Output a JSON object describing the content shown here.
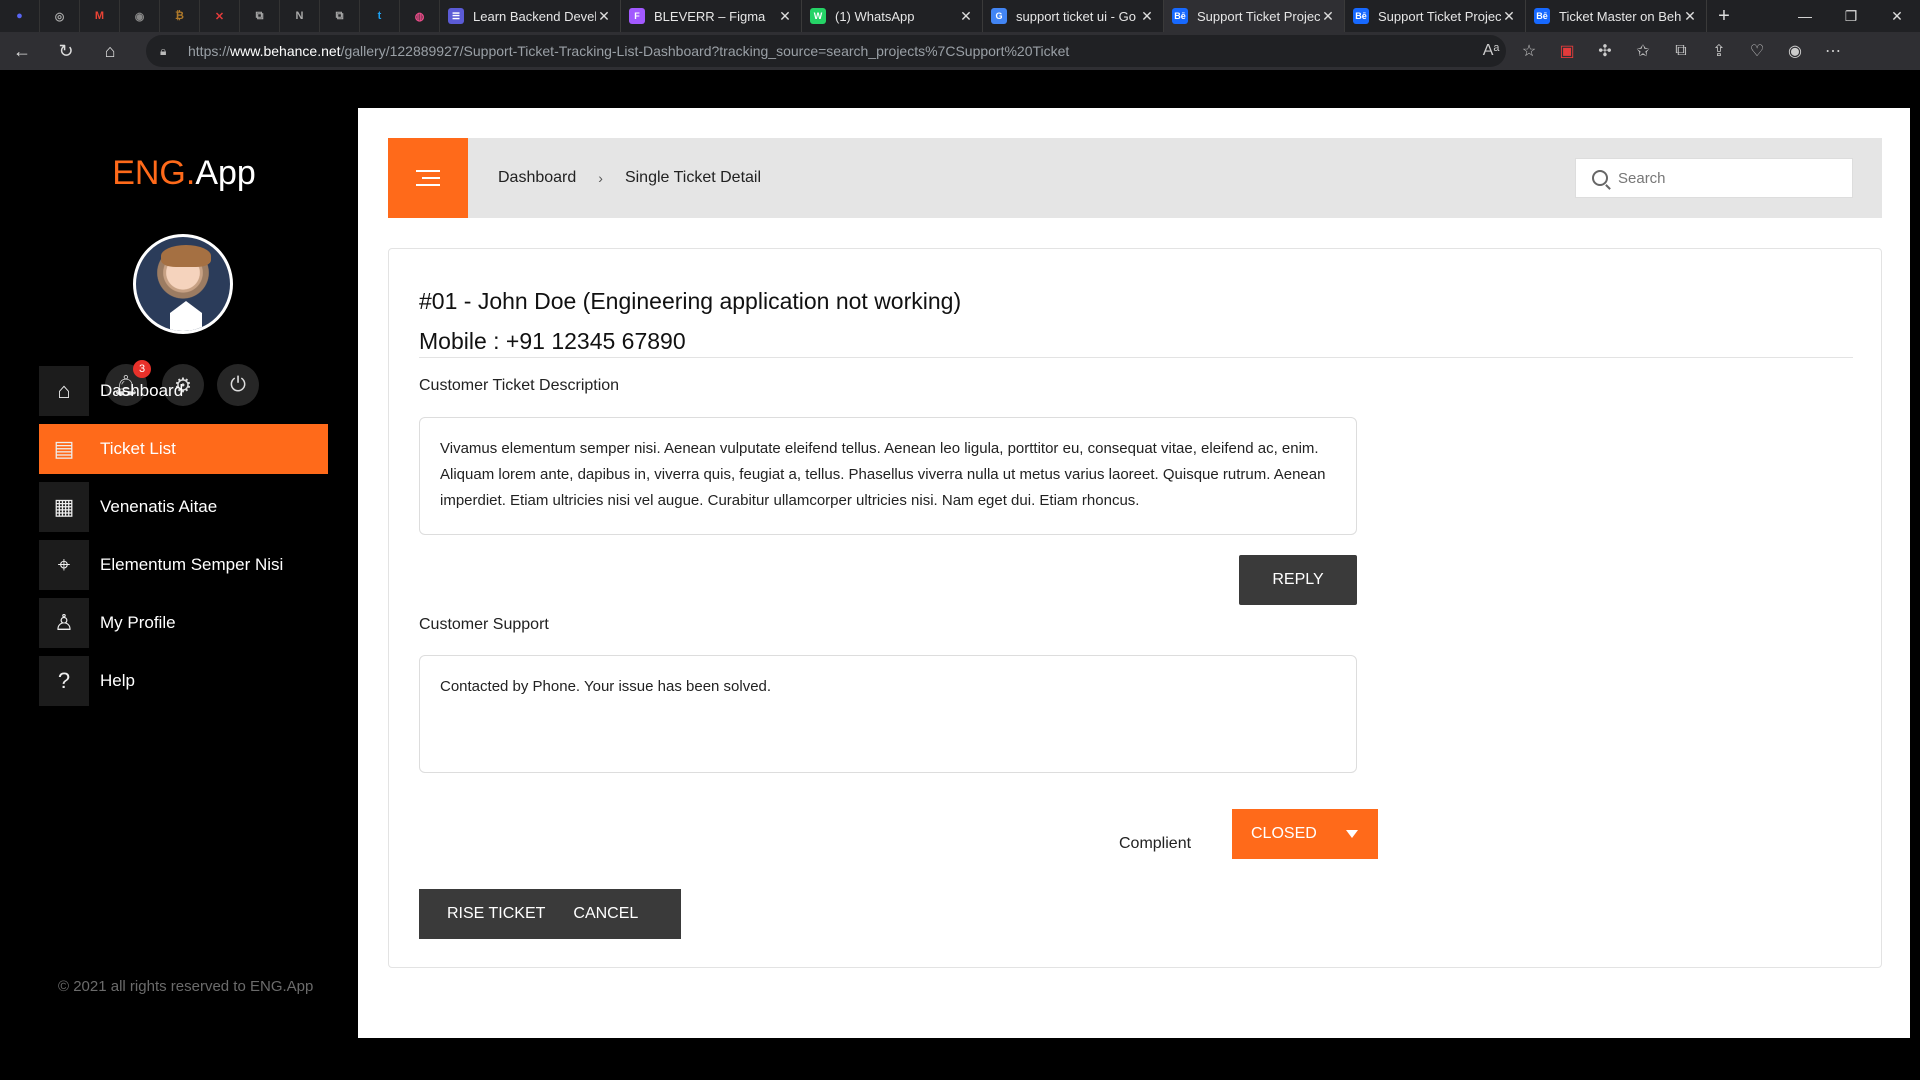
{
  "browser": {
    "pinned_tabs": [
      {
        "icon": "discord-icon",
        "glyph": "●",
        "color": "#5865f2"
      },
      {
        "icon": "github-icon",
        "glyph": "◎",
        "color": "#aaaaaa"
      },
      {
        "icon": "gmail-icon",
        "glyph": "M",
        "color": "#ea4335"
      },
      {
        "icon": "app-icon",
        "glyph": "◉",
        "color": "#888888"
      },
      {
        "icon": "coin-icon",
        "glyph": "₿",
        "color": "#b07a2a"
      },
      {
        "icon": "x-app-icon",
        "glyph": "✕",
        "color": "#e33b3b"
      },
      {
        "icon": "link-icon",
        "glyph": "⧉",
        "color": "#aaaaaa"
      },
      {
        "icon": "notion-icon",
        "glyph": "N",
        "color": "#aaaaaa"
      },
      {
        "icon": "link-icon",
        "glyph": "⧉",
        "color": "#aaaaaa"
      },
      {
        "icon": "twitter-icon",
        "glyph": "t",
        "color": "#1da1f2"
      },
      {
        "icon": "dribbble-icon",
        "glyph": "◍",
        "color": "#ea4c89"
      }
    ],
    "tabs": [
      {
        "title": "Learn Backend Develc",
        "fav": "☰",
        "fav_color": "#5b5bd6",
        "active": false
      },
      {
        "title": "BLEVERR – Figma",
        "fav": "F",
        "fav_color": "#a259ff",
        "active": false
      },
      {
        "title": "(1) WhatsApp",
        "fav": "W",
        "fav_color": "#25d366",
        "active": false
      },
      {
        "title": "support ticket ui - Go",
        "fav": "G",
        "fav_color": "#4285f4",
        "active": false
      },
      {
        "title": "Support Ticket Projec",
        "fav": "Bē",
        "fav_color": "#1769ff",
        "active": true
      },
      {
        "title": "Support Ticket Projec",
        "fav": "Bē",
        "fav_color": "#1769ff",
        "active": false
      },
      {
        "title": "Ticket Master on Beh",
        "fav": "Bē",
        "fav_color": "#1769ff",
        "active": false
      }
    ],
    "url_prefix": "https://",
    "url_host": "www.behance.net",
    "url_path": "/gallery/122889927/Support-Ticket-Tracking-List-Dashboard?tracking_source=search_projects%7CSupport%20Ticket"
  },
  "sidebar": {
    "logo_brand": "ENG.",
    "logo_rest": "App",
    "notification_count": "3",
    "items": [
      {
        "label": "Dashboard",
        "icon": "home-icon",
        "glyph": "⌂",
        "active": false
      },
      {
        "label": "Ticket List",
        "icon": "document-icon",
        "glyph": "▤",
        "active": true
      },
      {
        "label": "Venenatis Aitae",
        "icon": "calendar-icon",
        "glyph": "▦",
        "active": false
      },
      {
        "label": "Elementum Semper Nisi",
        "icon": "location-pin-icon",
        "glyph": "⌖",
        "active": false
      },
      {
        "label": "My Profile",
        "icon": "user-icon",
        "glyph": "♙",
        "active": false
      },
      {
        "label": "Help",
        "icon": "help-icon",
        "glyph": "?",
        "active": false
      }
    ],
    "footer": "© 2021 all rights reserved to ENG.App"
  },
  "header": {
    "breadcrumb_root": "Dashboard",
    "breadcrumb_current": "Single Ticket Detail",
    "search_placeholder": "Search"
  },
  "ticket": {
    "title": "#01 - John Doe (Engineering application not working)",
    "mobile": "Mobile : +91 12345 67890",
    "description_label": "Customer Ticket Description",
    "description": "Vivamus elementum semper nisi. Aenean vulputate eleifend tellus. Aenean leo ligula, porttitor eu, consequat vitae, eleifend ac, enim. Aliquam lorem ante, dapibus in, viverra quis, feugiat a, tellus. Phasellus viverra nulla ut metus varius laoreet. Quisque rutrum. Aenean imperdiet. Etiam ultricies nisi vel augue. Curabitur ullamcorper ultricies nisi. Nam eget dui. Etiam rhoncus.",
    "reply_label": "REPLY",
    "support_label": "Customer Support",
    "support_text": "Contacted by Phone.  Your issue has been solved.",
    "status_label": "Complient",
    "status_value": "CLOSED",
    "rise_label": "RISE TICKET",
    "cancel_label": "CANCEL"
  },
  "colors": {
    "accent": "#ff6a1a",
    "dark_button": "#3a3a3a"
  }
}
